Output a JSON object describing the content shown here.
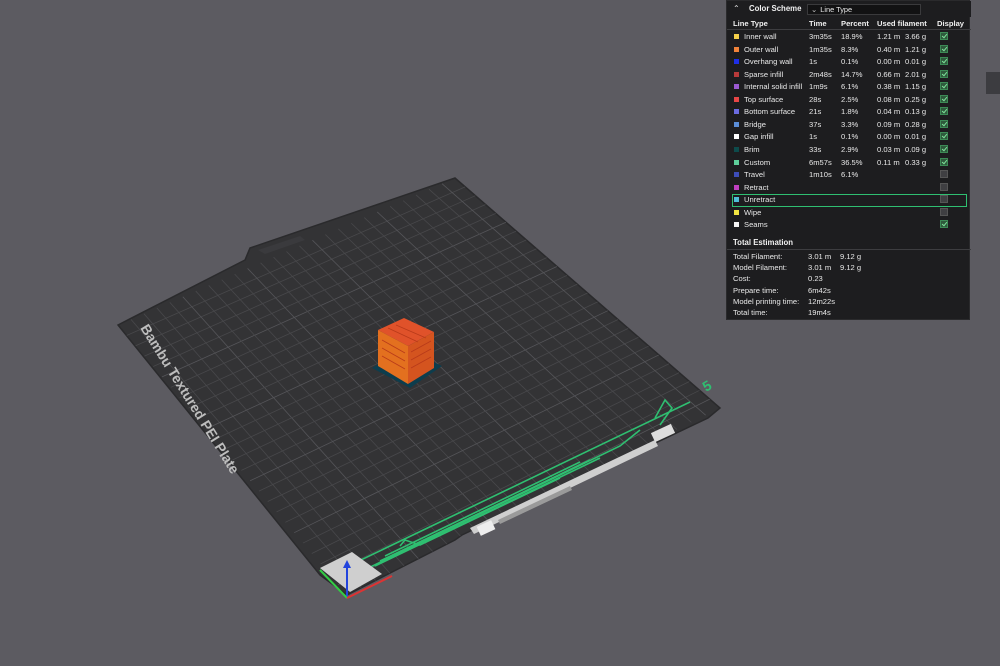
{
  "plate": {
    "label": "Bambu Textured PEI Plate",
    "plate_number": "5"
  },
  "colors": {
    "background": "#5c5b61",
    "plate": "#333335",
    "grid": "#4a4a4d",
    "accent_green": "#2fbf71",
    "cube_orange": "#e3701f",
    "cube_red": "#c9362a"
  },
  "legend": {
    "color_scheme_label": "Color Scheme",
    "scheme_value": "Line Type",
    "headers": {
      "type": "Line Type",
      "time": "Time",
      "percent": "Percent",
      "filament": "Used filament",
      "display": "Display"
    },
    "rows": [
      {
        "name": "Inner wall",
        "time": "3m35s",
        "percent": "18.9%",
        "filament": "1.21 m",
        "weight": "3.66 g",
        "color": "#f5d04a",
        "display": true
      },
      {
        "name": "Outer wall",
        "time": "1m35s",
        "percent": "8.3%",
        "filament": "0.40 m",
        "weight": "1.21 g",
        "color": "#f2833a",
        "display": true
      },
      {
        "name": "Overhang wall",
        "time": "1s",
        "percent": "0.1%",
        "filament": "0.00 m",
        "weight": "0.01 g",
        "color": "#1e2ee6",
        "display": true
      },
      {
        "name": "Sparse infill",
        "time": "2m48s",
        "percent": "14.7%",
        "filament": "0.66 m",
        "weight": "2.01 g",
        "color": "#b83a3a",
        "display": true
      },
      {
        "name": "Internal solid infill",
        "time": "1m9s",
        "percent": "6.1%",
        "filament": "0.38 m",
        "weight": "1.15 g",
        "color": "#9b59d0",
        "display": true
      },
      {
        "name": "Top surface",
        "time": "28s",
        "percent": "2.5%",
        "filament": "0.08 m",
        "weight": "0.25 g",
        "color": "#e84646",
        "display": true
      },
      {
        "name": "Bottom surface",
        "time": "21s",
        "percent": "1.8%",
        "filament": "0.04 m",
        "weight": "0.13 g",
        "color": "#6b6be0",
        "display": true
      },
      {
        "name": "Bridge",
        "time": "37s",
        "percent": "3.3%",
        "filament": "0.09 m",
        "weight": "0.28 g",
        "color": "#5b8ed8",
        "display": true
      },
      {
        "name": "Gap infill",
        "time": "1s",
        "percent": "0.1%",
        "filament": "0.00 m",
        "weight": "0.01 g",
        "color": "#ffffff",
        "display": true
      },
      {
        "name": "Brim",
        "time": "33s",
        "percent": "2.9%",
        "filament": "0.03 m",
        "weight": "0.09 g",
        "color": "#0d4b4b",
        "display": true
      },
      {
        "name": "Custom",
        "time": "6m57s",
        "percent": "36.5%",
        "filament": "0.11 m",
        "weight": "0.33 g",
        "color": "#5ecf9a",
        "display": true
      },
      {
        "name": "Travel",
        "time": "1m10s",
        "percent": "6.1%",
        "filament": "",
        "weight": "",
        "color": "#3d4db8",
        "display": false
      },
      {
        "name": "Retract",
        "time": "",
        "percent": "",
        "filament": "",
        "weight": "",
        "color": "#c040c0",
        "display": false
      },
      {
        "name": "Unretract",
        "time": "",
        "percent": "",
        "filament": "",
        "weight": "",
        "color": "#4fc0d8",
        "display": false,
        "highlighted": true
      },
      {
        "name": "Wipe",
        "time": "",
        "percent": "",
        "filament": "",
        "weight": "",
        "color": "#f2e542",
        "display": false
      },
      {
        "name": "Seams",
        "time": "",
        "percent": "",
        "filament": "",
        "weight": "",
        "color": "#f5f5f5",
        "display": true
      }
    ],
    "estimation": {
      "title": "Total Estimation",
      "items": [
        {
          "label": "Total Filament:",
          "v1": "3.01 m",
          "v2": "9.12 g"
        },
        {
          "label": "Model Filament:",
          "v1": "3.01 m",
          "v2": "9.12 g"
        },
        {
          "label": "Cost:",
          "v1": "0.23",
          "v2": ""
        },
        {
          "label": "Prepare time:",
          "v1": "6m42s",
          "v2": ""
        },
        {
          "label": "Model printing time:",
          "v1": "12m22s",
          "v2": ""
        },
        {
          "label": "Total time:",
          "v1": "19m4s",
          "v2": ""
        }
      ]
    }
  }
}
